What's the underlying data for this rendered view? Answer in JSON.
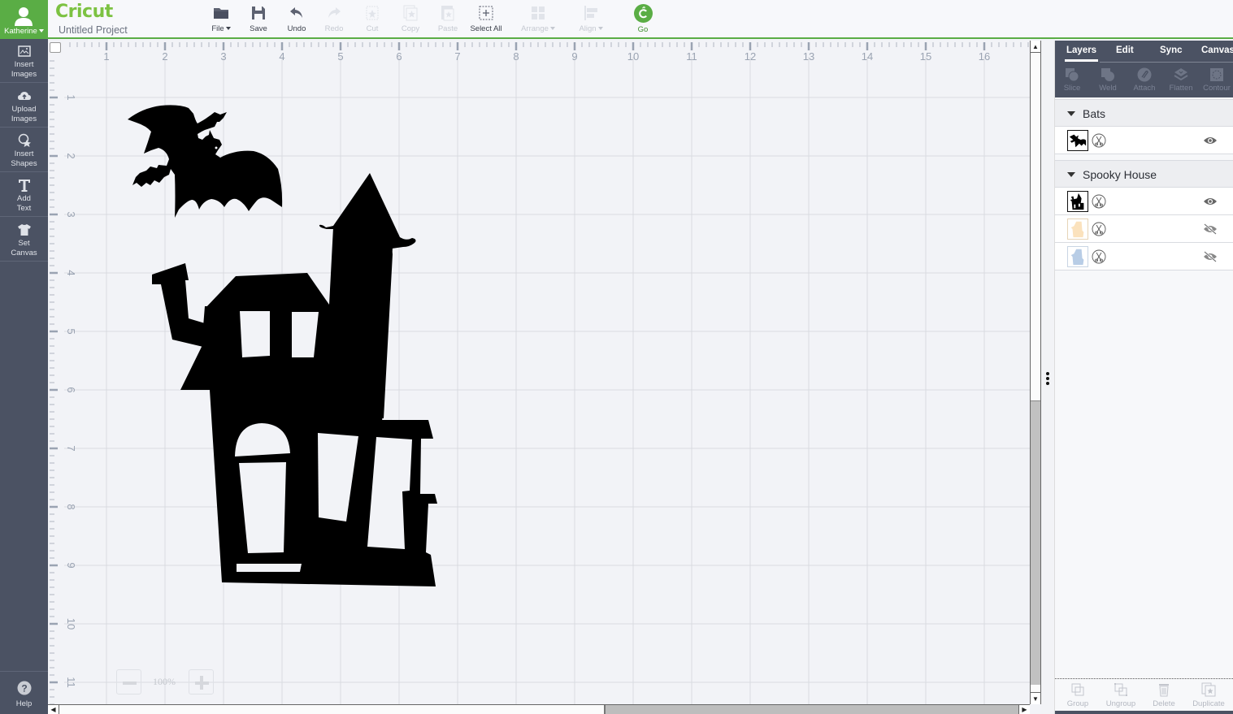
{
  "user": {
    "name": "Katherine"
  },
  "brand": {
    "logo": "Cricut",
    "project_title": "Untitled Project",
    "accent": "#5aad45"
  },
  "toolbar": [
    {
      "id": "file",
      "label": "File",
      "icon": "folder-icon",
      "enabled": true,
      "dropdown": true
    },
    {
      "id": "save",
      "label": "Save",
      "icon": "save-icon",
      "enabled": true
    },
    {
      "id": "undo",
      "label": "Undo",
      "icon": "undo-icon",
      "enabled": true
    },
    {
      "id": "redo",
      "label": "Redo",
      "icon": "redo-icon",
      "enabled": false
    },
    {
      "id": "cut",
      "label": "Cut",
      "icon": "cut-icon",
      "enabled": false
    },
    {
      "id": "copy",
      "label": "Copy",
      "icon": "copy-icon",
      "enabled": false
    },
    {
      "id": "paste",
      "label": "Paste",
      "icon": "paste-icon",
      "enabled": false
    },
    {
      "id": "select_all",
      "label": "Select All",
      "icon": "select-all-icon",
      "enabled": true
    },
    {
      "id": "arrange",
      "label": "Arrange",
      "icon": "arrange-icon",
      "enabled": false,
      "dropdown": true
    },
    {
      "id": "align",
      "label": "Align",
      "icon": "align-icon",
      "enabled": false,
      "dropdown": true
    },
    {
      "id": "go",
      "label": "Go",
      "icon": "go-icon",
      "enabled": true
    }
  ],
  "sidebar": {
    "items": [
      {
        "label1": "Insert",
        "label2": "Images",
        "icon": "image-icon"
      },
      {
        "label1": "Upload",
        "label2": "Images",
        "icon": "cloud-upload-icon"
      },
      {
        "label1": "Insert",
        "label2": "Shapes",
        "icon": "shapes-icon"
      },
      {
        "label1": "Add",
        "label2": "Text",
        "icon": "text-icon"
      },
      {
        "label1": "Set",
        "label2": "Canvas",
        "icon": "shirt-icon"
      }
    ],
    "help": "Help"
  },
  "canvas": {
    "ruler_x": [
      "1",
      "2",
      "3",
      "4",
      "5",
      "6",
      "7",
      "8",
      "9",
      "10",
      "11",
      "12",
      "13",
      "14",
      "15",
      "16"
    ],
    "ruler_y": [
      "1",
      "2",
      "3",
      "4",
      "5",
      "6",
      "7",
      "8",
      "9",
      "10",
      "11"
    ],
    "zoom": "100%"
  },
  "right_panel": {
    "tabs": [
      "Layers",
      "Edit",
      "Sync",
      "Canvas"
    ],
    "active_tab": "Layers",
    "tools": [
      "Slice",
      "Weld",
      "Attach",
      "Flatten",
      "Contour"
    ],
    "groups": [
      {
        "name": "Bats",
        "layers": [
          {
            "thumb": "bat",
            "visible": true
          }
        ]
      },
      {
        "name": "Spooky House",
        "layers": [
          {
            "thumb": "house-black",
            "visible": true
          },
          {
            "thumb": "house-peach",
            "visible": false
          },
          {
            "thumb": "house-blue",
            "visible": false
          }
        ]
      }
    ],
    "bottom_tools": [
      "Group",
      "Ungroup",
      "Delete",
      "Duplicate"
    ]
  }
}
